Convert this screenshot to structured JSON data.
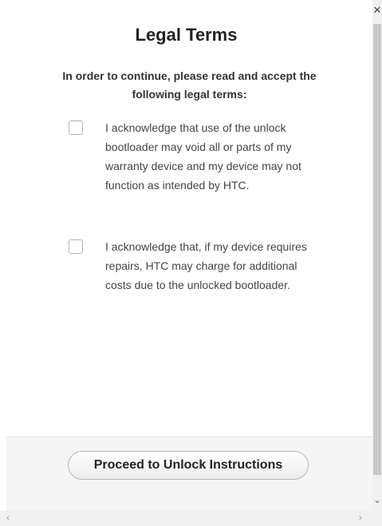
{
  "dialog": {
    "title": "Legal Terms",
    "intro": "In order to continue, please read and accept the following legal terms:",
    "terms": [
      {
        "text": "I acknowledge that use of the unlock bootloader may void all or parts of my warranty device and my device may not function as intended by HTC.",
        "checked": false
      },
      {
        "text": "I acknowledge that, if my device requires repairs, HTC may charge for additional costs due to the unlocked bootloader.",
        "checked": false
      }
    ],
    "proceed_label": "Proceed to Unlock Instructions"
  },
  "icons": {
    "close": "close-icon",
    "scroll_down": "chevron-down-icon",
    "scroll_left": "chevron-left-icon",
    "scroll_right": "chevron-right-icon"
  },
  "colors": {
    "footer_bg": "#f5f5f5",
    "text": "#333333",
    "checkbox_border": "#b0b0b0"
  }
}
